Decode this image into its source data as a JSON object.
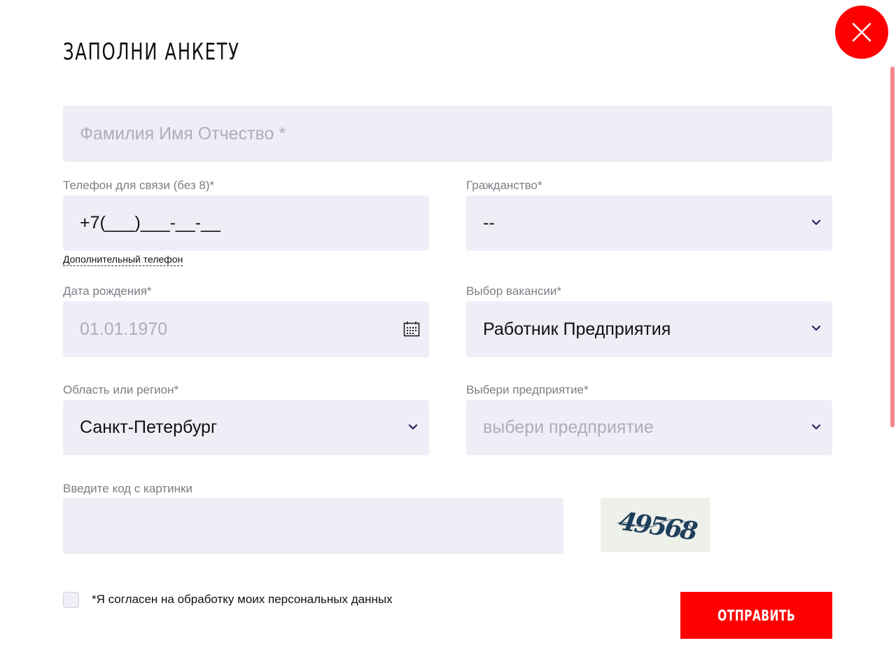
{
  "form": {
    "title": "ЗАПОЛНИ АНКЕТУ",
    "fio": {
      "placeholder": "Фамилия Имя Отчество *"
    },
    "phone": {
      "label": "Телефон для связи (без 8)*",
      "value": "+7(___)___-__-__"
    },
    "extra_phone_link": "Дополнительный телефон",
    "citizenship": {
      "label": "Гражданство*",
      "value": "--"
    },
    "birth_date": {
      "label": "Дата рождения*",
      "placeholder": "01.01.1970"
    },
    "vacancy": {
      "label": "Выбор вакансии*",
      "value": "Работник Предприятия"
    },
    "region": {
      "label": "Область или регион*",
      "value": "Санкт-Петербург"
    },
    "enterprise": {
      "label": "Выбери предприятие*",
      "placeholder": "выбери предприятие"
    },
    "captcha": {
      "label": "Введите код с картинки",
      "code": "49568"
    },
    "consent": {
      "label": "*Я согласен на обработку моих персональных данных",
      "checked": false
    },
    "submit_label": "ОТПРАВИТЬ"
  },
  "icons": {
    "close": "close-icon",
    "chevron": "chevron-down-icon",
    "calendar": "calendar-icon"
  },
  "colors": {
    "accent": "#ff0000",
    "field_bg": "#eeeef7",
    "label": "#7d7d86",
    "placeholder": "#aeaeb8",
    "chevron": "#2d1f5e",
    "captcha_ink": "#1f3f5c"
  }
}
